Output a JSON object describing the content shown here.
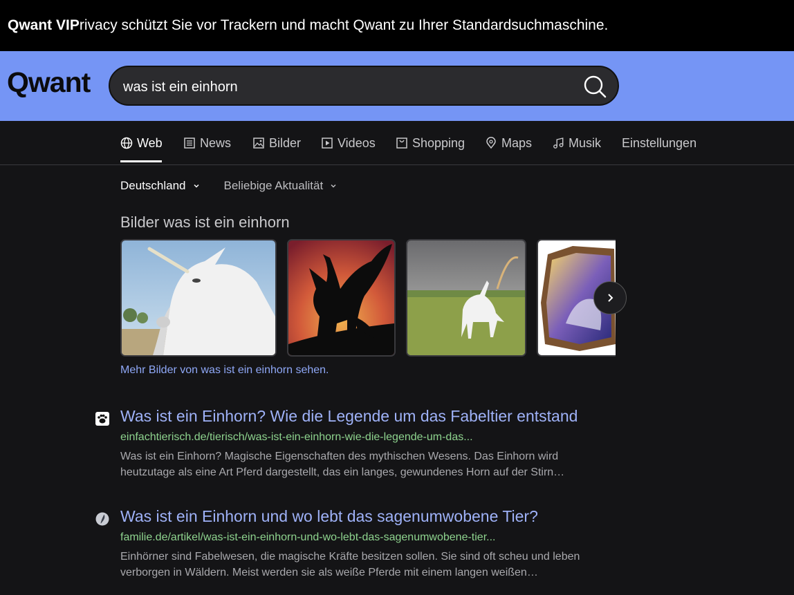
{
  "banner": {
    "brand": "Qwant VIP",
    "message": "rivacy schützt Sie vor Trackern und macht Qwant zu Ihrer Standardsuchmaschine."
  },
  "header": {
    "logo": "Qwant",
    "search_value": "was ist ein einhorn",
    "search_icon": "search-icon",
    "accent_color": "#7595f5"
  },
  "tabs": [
    {
      "label": "Web",
      "icon": "globe-icon",
      "active": true
    },
    {
      "label": "News",
      "icon": "newspaper-icon"
    },
    {
      "label": "Bilder",
      "icon": "image-icon"
    },
    {
      "label": "Videos",
      "icon": "play-icon"
    },
    {
      "label": "Shopping",
      "icon": "bag-icon"
    },
    {
      "label": "Maps",
      "icon": "pin-icon"
    },
    {
      "label": "Musik",
      "icon": "music-icon"
    },
    {
      "label": "Einstellungen"
    }
  ],
  "filters": [
    {
      "label": "Deutschland"
    },
    {
      "label": "Beliebige Aktualität"
    }
  ],
  "images": {
    "title": "Bilder was ist ein einhorn",
    "more_link": "Mehr Bilder von was ist ein einhorn sehen."
  },
  "results": [
    {
      "title": "Was ist ein Einhorn? Wie die Legende um das Fabeltier entstand",
      "url": "einfachtierisch.de/tierisch/was-ist-ein-einhorn-wie-die-legende-um-das...",
      "description": "Was ist ein Einhorn? Magische Eigenschaften des mythischen Wesens. Das Einhorn wird heutzutage als eine Art Pferd dargestellt, das ein langes, gewundenes Horn auf der Stirn…"
    },
    {
      "title": "Was ist ein Einhorn und wo lebt das sagenumwobene Tier?",
      "url": "familie.de/artikel/was-ist-ein-einhorn-und-wo-lebt-das-sagenumwobene-tier...",
      "description": "Einhörner sind Fabelwesen, die magische Kräfte besitzen sollen. Sie sind oft scheu und leben verborgen in Wäldern. Meist werden sie als weiße Pferde mit einem langen weißen…"
    }
  ]
}
